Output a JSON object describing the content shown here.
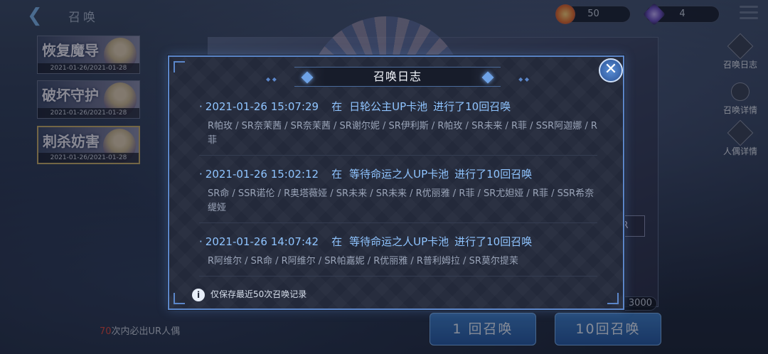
{
  "header": {
    "back_icon": "chevron-left-icon",
    "title": "召唤",
    "resource_1": {
      "icon": "crystal-orb-icon",
      "value": "50"
    },
    "resource_2": {
      "icon": "crystal-shard-icon",
      "value": "4"
    },
    "menu_icon": "hamburger-menu-icon"
  },
  "banners": [
    {
      "name": "恢复魔导",
      "date": "2021-01-26/2021-01-28"
    },
    {
      "name": "破坏守护",
      "date": "2021-01-26/2021-01-28"
    },
    {
      "name": "刺杀妨害",
      "date": "2021-01-26/2021-01-28"
    }
  ],
  "side_menu": [
    {
      "label": "召唤日志",
      "icon": "log-book-icon"
    },
    {
      "label": "召唤详情",
      "icon": "details-dots-icon"
    },
    {
      "label": "人偶详情",
      "icon": "doll-search-icon"
    }
  ],
  "bottom": {
    "ur_hint_number": "70",
    "ur_hint_text": "次内必出UR人偶",
    "cost": "3000",
    "single_summon_label": "1 回召唤",
    "ten_summon_label": "10回召唤"
  },
  "background": {
    "banner_tag": "R"
  },
  "modal": {
    "title": "召唤日志",
    "close_icon": "close-x-icon",
    "notice": "仅保存最近50次召唤记录",
    "notice_icon": "info-icon",
    "records": [
      {
        "time": "2021-01-26 15:07:29",
        "at": "在",
        "pool": "日轮公主UP卡池",
        "action": "进行了10回召唤",
        "items": "R帕玫 / SR奈茉茜 / SR奈茉茜 / SR谢尔妮 / SR伊利斯 / R帕玫 / SR未来 / R菲 / SSR阿迦娜 / R菲"
      },
      {
        "time": "2021-01-26 15:02:12",
        "at": "在",
        "pool": "等待命运之人UP卡池",
        "action": "进行了10回召唤",
        "items": "SR命 / SSR诺伦 / R奥塔薇娅 / SR未来 / SR未来 / R优丽雅 / R菲 / SR尤妲娅 / R菲 / SSR希奈缇娅"
      },
      {
        "time": "2021-01-26 14:07:42",
        "at": "在",
        "pool": "等待命运之人UP卡池",
        "action": "进行了10回召唤",
        "items": "R阿维尔 / SR命 / R阿维尔 / SR帕嘉妮 / R优丽雅 / R普利姆拉 / SR莫尔提茉"
      }
    ]
  }
}
